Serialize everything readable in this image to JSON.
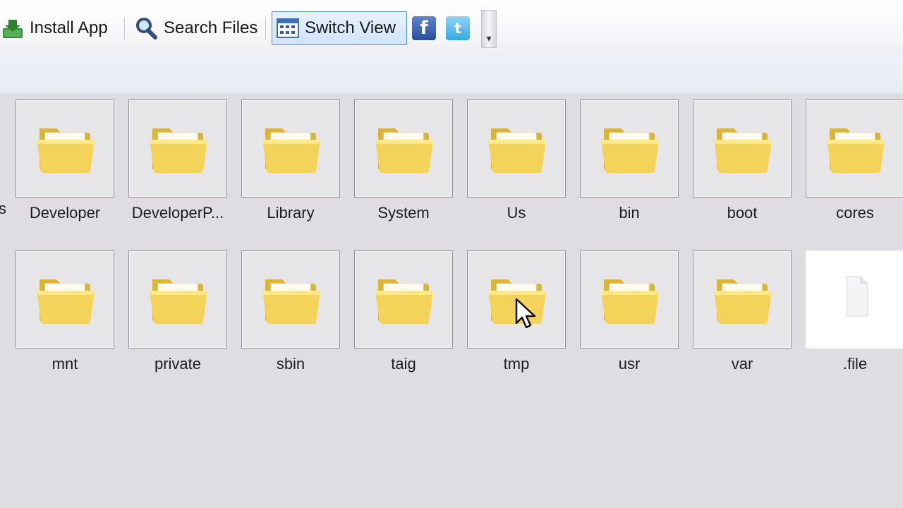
{
  "toolbar": {
    "install_label": "Install App",
    "search_label": "Search Files",
    "switch_label": "Switch View",
    "facebook_glyph": "f",
    "twitter_glyph": "t",
    "overflow_glyph": "▾"
  },
  "row_stub_label": "s",
  "folders": [
    {
      "name": "Developer"
    },
    {
      "name": "DeveloperP..."
    },
    {
      "name": "Library"
    },
    {
      "name": "System"
    },
    {
      "name": "Us"
    },
    {
      "name": "bin"
    },
    {
      "name": "boot"
    },
    {
      "name": "cores"
    },
    {
      "name": "mnt"
    },
    {
      "name": "private"
    },
    {
      "name": "sbin"
    },
    {
      "name": "taig"
    },
    {
      "name": "tmp"
    },
    {
      "name": "usr"
    },
    {
      "name": "var"
    },
    {
      "name": ".file"
    }
  ],
  "colors": {
    "accent": "#4f8fd6",
    "folder": "#f3d35a",
    "background": "#dfdde2"
  }
}
